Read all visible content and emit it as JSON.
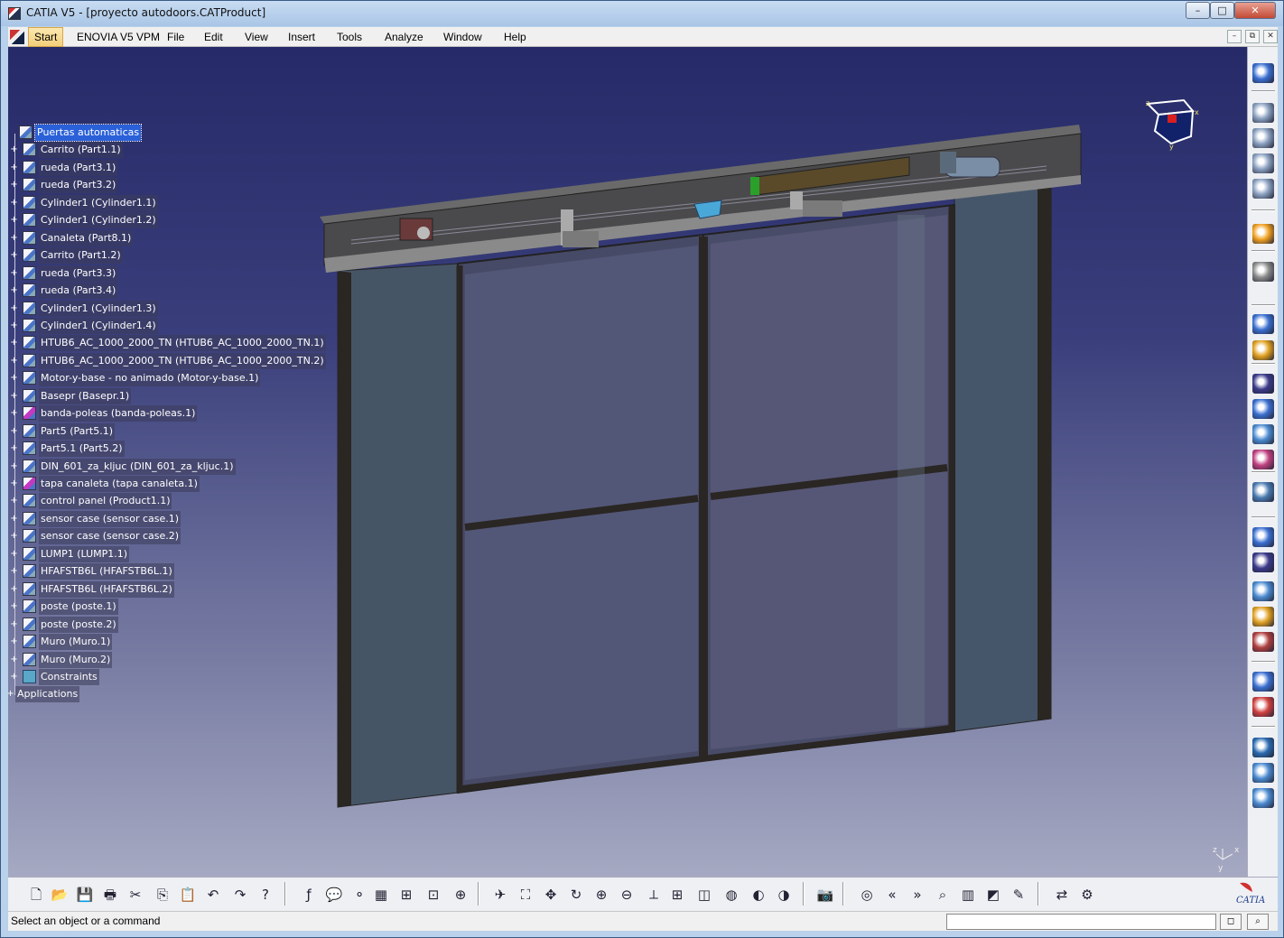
{
  "window": {
    "title": "CATIA V5 - [proyecto autodoors.CATProduct]",
    "minimize": "–",
    "maximize": "□",
    "close": "✕"
  },
  "menu": {
    "items": [
      "Start",
      "ENOVIA V5 VPM",
      "File",
      "Edit",
      "View",
      "Insert",
      "Tools",
      "Analyze",
      "Window",
      "Help"
    ],
    "mdi": [
      "–",
      "⧉",
      "✕"
    ]
  },
  "tree": {
    "root": "Puertas automaticas",
    "items": [
      "Carrito (Part1.1)",
      "rueda (Part3.1)",
      "rueda (Part3.2)",
      "Cylinder1 (Cylinder1.1)",
      "Cylinder1 (Cylinder1.2)",
      "Canaleta (Part8.1)",
      "Carrito (Part1.2)",
      "rueda (Part3.3)",
      "rueda (Part3.4)",
      "Cylinder1 (Cylinder1.3)",
      "Cylinder1 (Cylinder1.4)",
      "HTUB6_AC_1000_2000_TN (HTUB6_AC_1000_2000_TN.1)",
      "HTUB6_AC_1000_2000_TN (HTUB6_AC_1000_2000_TN.2)",
      "Motor-y-base - no animado (Motor-y-base.1)",
      "Basepr (Basepr.1)",
      "banda-poleas (banda-poleas.1)",
      "Part5 (Part5.1)",
      "Part5.1 (Part5.2)",
      "DIN_601_za_kljuc (DIN_601_za_kljuc.1)",
      "tapa canaleta (tapa canaleta.1)",
      "control panel (Product1.1)",
      "sensor case (sensor case.1)",
      "sensor case (sensor case.2)",
      "LUMP1 (LUMP1.1)",
      "HFAFSTB6L (HFAFSTB6L.1)",
      "HFAFSTB6L (HFAFSTB6L.2)",
      "poste (poste.1)",
      "poste (poste.2)",
      "Muro (Muro.1)",
      "Muro (Muro.2)",
      "Constraints",
      "Applications"
    ]
  },
  "compass": {
    "x_label": "x",
    "y_label": "y",
    "z_label": "z"
  },
  "axis_triad": {
    "x_label": "x",
    "y_label": "y",
    "z_label": "z"
  },
  "status": {
    "message": "Select an object or a command",
    "command_input": ""
  },
  "brand": {
    "logo_text": "CATIA"
  },
  "colors": {
    "selection": "#2a60d8",
    "viewport_top": "#262a68",
    "viewport_bottom": "#a6a9c2",
    "close_button": "#c24a35"
  },
  "bottom_toolbar": {
    "icons": [
      "new-icon",
      "open-icon",
      "save-icon",
      "print-icon",
      "cut-icon",
      "copy-icon",
      "paste-icon",
      "undo-icon",
      "redo-icon",
      "whats-this-icon",
      "formula-icon",
      "knowledge-icon",
      "light-icon",
      "table-icon",
      "product-structure-icon",
      "catalog-icon",
      "measure-icon",
      "fly-mode-icon",
      "fit-all-icon",
      "pan-icon",
      "rotate-icon",
      "zoom-in-icon",
      "zoom-out-icon",
      "normal-view-icon",
      "multi-view-icon",
      "isometric-view-icon",
      "shading-icon",
      "hide-show-icon",
      "swap-visible-icon",
      "camera-icon",
      "compass-icon",
      "previous-icon",
      "next-icon",
      "search-icon",
      "sections-icon",
      "render-icon",
      "manipulate-icon",
      "compare-icon",
      "tools-icon"
    ]
  },
  "right_toolbar": {
    "icons": [
      "fly-icon",
      "new-component-icon",
      "new-product-icon",
      "new-part-icon",
      "existing-component-icon",
      "select-icon",
      "select-mode-icon",
      "snap-icon",
      "manipulate-icon",
      "explode-icon",
      "fix-icon",
      "contact-icon",
      "offset-icon",
      "angle-icon",
      "check-icon",
      "clash-icon",
      "simulation-icon",
      "sectioning-icon",
      "track-icon",
      "sequence-icon",
      "publish-icon",
      "scene-icon",
      "catalog-icon",
      "reconcile-icon",
      "update-icon"
    ]
  }
}
